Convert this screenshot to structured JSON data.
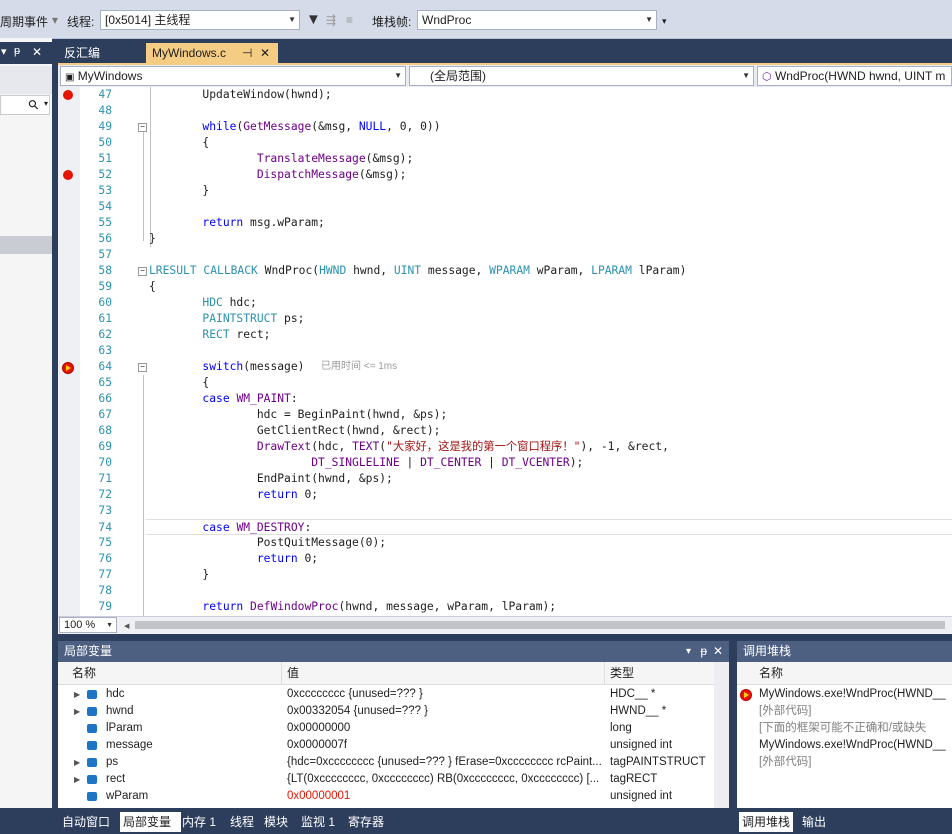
{
  "toolbar": {
    "lifecycle_label": "周期事件",
    "thread_label": "线程:",
    "thread_value": "[0x5014] 主线程",
    "stackframe_label": "堆栈帧:",
    "stackframe_value": "WndProc"
  },
  "left_panel": {
    "pin": "ᵽ",
    "close": "✕",
    "search_icon": "⚲"
  },
  "doc_tabs": [
    {
      "label": "反汇编",
      "active": false
    },
    {
      "label": "MyWindows.c",
      "active": true
    }
  ],
  "tab_pin": "⊣",
  "tab_close": "✕",
  "navbar": {
    "project": "MyWindows",
    "scope": "(全局范围)",
    "member": "WndProc(HWND hwnd, UINT m"
  },
  "code": {
    "lines": [
      {
        "n": "47",
        "t": "        UpdateWindow(hwnd);"
      },
      {
        "n": "48",
        "t": ""
      },
      {
        "n": "49",
        "t": "        while(GetMessage(&msg, NULL, 0, 0))"
      },
      {
        "n": "50",
        "t": "        {"
      },
      {
        "n": "51",
        "t": "                TranslateMessage(&msg);"
      },
      {
        "n": "52",
        "t": "                DispatchMessage(&msg);"
      },
      {
        "n": "53",
        "t": "        }"
      },
      {
        "n": "54",
        "t": ""
      },
      {
        "n": "55",
        "t": "        return msg.wParam;"
      },
      {
        "n": "56",
        "t": "}"
      },
      {
        "n": "57",
        "t": ""
      },
      {
        "n": "58",
        "t": "LRESULT CALLBACK WndProc(HWND hwnd, UINT message, WPARAM wParam, LPARAM lParam)"
      },
      {
        "n": "59",
        "t": "{"
      },
      {
        "n": "60",
        "t": "        HDC hdc;"
      },
      {
        "n": "61",
        "t": "        PAINTSTRUCT ps;"
      },
      {
        "n": "62",
        "t": "        RECT rect;"
      },
      {
        "n": "63",
        "t": ""
      },
      {
        "n": "64",
        "t": "        switch(message)"
      },
      {
        "n": "65",
        "t": "        {"
      },
      {
        "n": "66",
        "t": "        case WM_PAINT:"
      },
      {
        "n": "67",
        "t": "                hdc = BeginPaint(hwnd, &ps);"
      },
      {
        "n": "68",
        "t": "                GetClientRect(hwnd, &rect);"
      },
      {
        "n": "69",
        "t": "                DrawText(hdc, TEXT(\"大家好，这是我的第一个窗口程序！\"), -1, &rect,"
      },
      {
        "n": "70",
        "t": "                        DT_SINGLELINE | DT_CENTER | DT_VCENTER);"
      },
      {
        "n": "71",
        "t": "                EndPaint(hwnd, &ps);"
      },
      {
        "n": "72",
        "t": "                return 0;"
      },
      {
        "n": "73",
        "t": ""
      },
      {
        "n": "74",
        "t": "        case WM_DESTROY:"
      },
      {
        "n": "75",
        "t": "                PostQuitMessage(0);"
      },
      {
        "n": "76",
        "t": "                return 0;"
      },
      {
        "n": "77",
        "t": "        }"
      },
      {
        "n": "78",
        "t": ""
      },
      {
        "n": "79",
        "t": "        return DefWindowProc(hwnd, message, wParam, lParam);"
      }
    ],
    "elapsed_hint": "已用时间 <= 1ms"
  },
  "zoom": "100 %",
  "locals": {
    "title": "局部变量",
    "columns": [
      "名称",
      "值",
      "类型"
    ],
    "rows": [
      {
        "name": "hdc",
        "value": "0xcccccccc {unused=??? }",
        "type": "HDC__ *",
        "expandable": true,
        "changed": false
      },
      {
        "name": "hwnd",
        "value": "0x00332054 {unused=??? }",
        "type": "HWND__ *",
        "expandable": true,
        "changed": false
      },
      {
        "name": "lParam",
        "value": "0x00000000",
        "type": "long",
        "expandable": false,
        "changed": false
      },
      {
        "name": "message",
        "value": "0x0000007f",
        "type": "unsigned int",
        "expandable": false,
        "changed": false
      },
      {
        "name": "ps",
        "value": "{hdc=0xcccccccc {unused=??? } fErase=0xcccccccc rcPaint...",
        "type": "tagPAINTSTRUCT",
        "expandable": true,
        "changed": false
      },
      {
        "name": "rect",
        "value": "{LT(0xcccccccc, 0xcccccccc) RB(0xcccccccc, 0xcccccccc)  [...",
        "type": "tagRECT",
        "expandable": true,
        "changed": false
      },
      {
        "name": "wParam",
        "value": "0x00000001",
        "type": "unsigned int",
        "expandable": false,
        "changed": true
      }
    ]
  },
  "callstack": {
    "title": "调用堆栈",
    "column": "名称",
    "rows": [
      {
        "text": "MyWindows.exe!WndProc(HWND__",
        "current": true,
        "dim": false
      },
      {
        "text": "[外部代码]",
        "current": false,
        "dim": true
      },
      {
        "text": "[下面的框架可能不正确和/或缺失",
        "current": false,
        "dim": true
      },
      {
        "text": "MyWindows.exe!WndProc(HWND__",
        "current": false,
        "dim": false
      },
      {
        "text": "[外部代码]",
        "current": false,
        "dim": true
      }
    ]
  },
  "bottom_tabs_left": [
    "自动窗口",
    "局部变量",
    "内存 1",
    "线程",
    "模块",
    "监视 1",
    "寄存器"
  ],
  "bottom_tabs_right": [
    "调用堆栈",
    "输出"
  ],
  "colors": {
    "chrome": "#2d3e5d",
    "active_tab": "#f5cc84",
    "changed_value": "#e51400"
  }
}
